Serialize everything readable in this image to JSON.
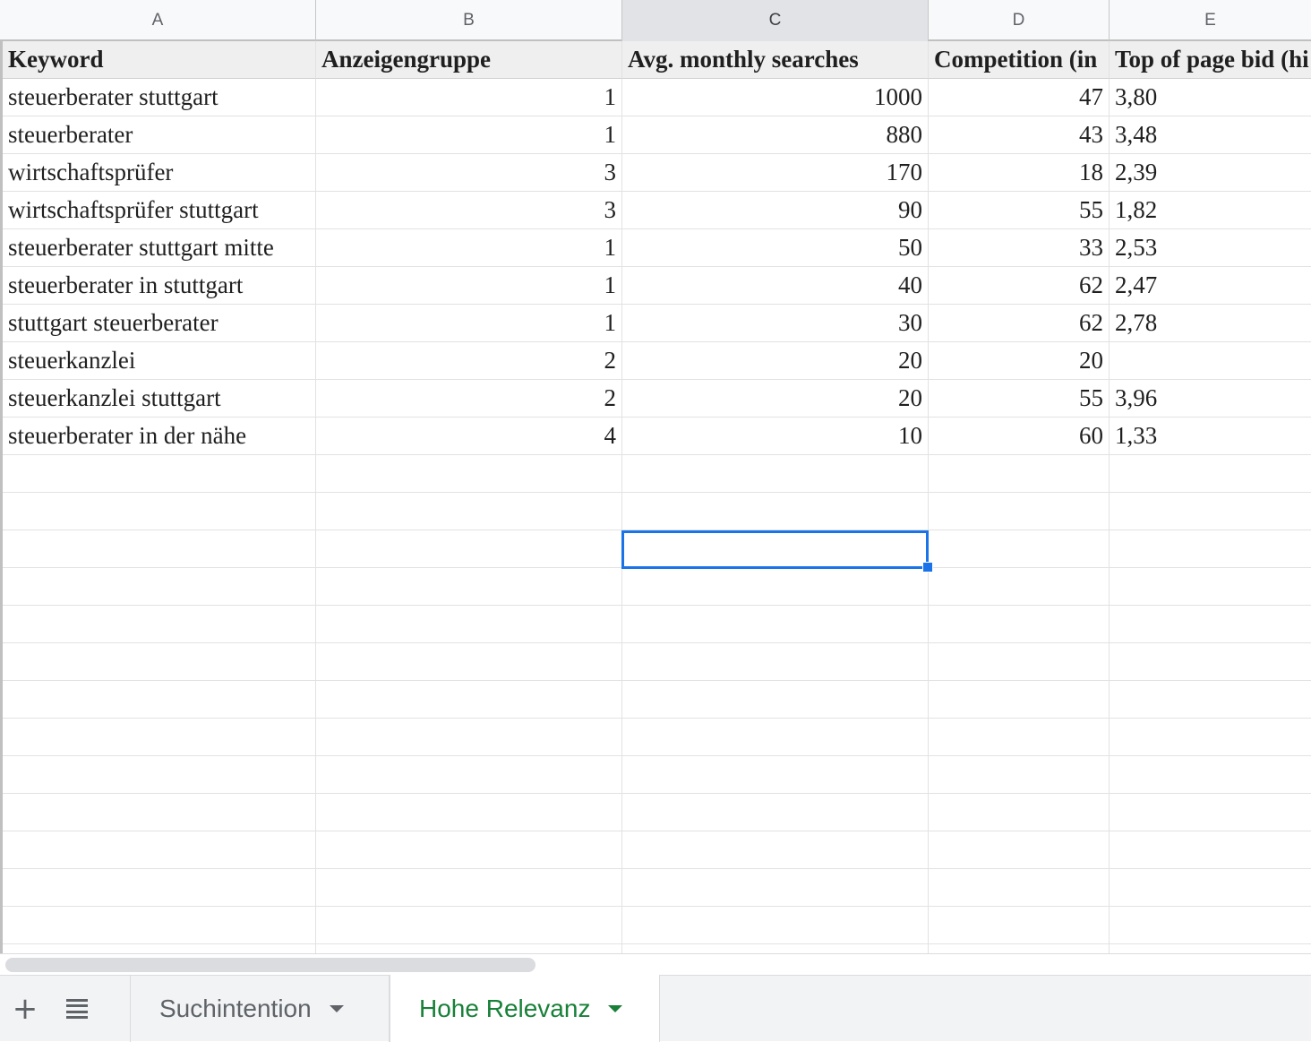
{
  "columns": [
    "A",
    "B",
    "C",
    "D",
    "E"
  ],
  "header": [
    "Keyword",
    "Anzeigengruppe",
    "Avg. monthly searches",
    "Competition (in",
    "Top of page bid (hi"
  ],
  "rows": [
    [
      "steuerberater stuttgart",
      "1",
      "1000",
      "47",
      "3,80"
    ],
    [
      "steuerberater",
      "1",
      "880",
      "43",
      "3,48"
    ],
    [
      "wirtschaftsprüfer",
      "3",
      "170",
      "18",
      "2,39"
    ],
    [
      "wirtschaftsprüfer stuttgart",
      "3",
      "90",
      "55",
      "1,82"
    ],
    [
      "steuerberater stuttgart mitte",
      "1",
      "50",
      "33",
      "2,53"
    ],
    [
      "steuerberater in stuttgart",
      "1",
      "40",
      "62",
      "2,47"
    ],
    [
      "stuttgart steuerberater",
      "1",
      "30",
      "62",
      "2,78"
    ],
    [
      "steuerkanzlei",
      "2",
      "20",
      "20",
      ""
    ],
    [
      "steuerkanzlei stuttgart",
      "2",
      "20",
      "55",
      "3,96"
    ],
    [
      "steuerberater in der nähe",
      "4",
      "10",
      "60",
      "1,33"
    ]
  ],
  "tabs": [
    {
      "label": "Suchintention",
      "active": false
    },
    {
      "label": "Hohe Relevanz",
      "active": true
    }
  ],
  "icons": {
    "add_sheet": "plus-icon",
    "all_sheets": "list-icon",
    "tab_menu": "caret-down-icon"
  },
  "colors": {
    "selection": "#1a73e8",
    "active_tab": "#188038"
  }
}
